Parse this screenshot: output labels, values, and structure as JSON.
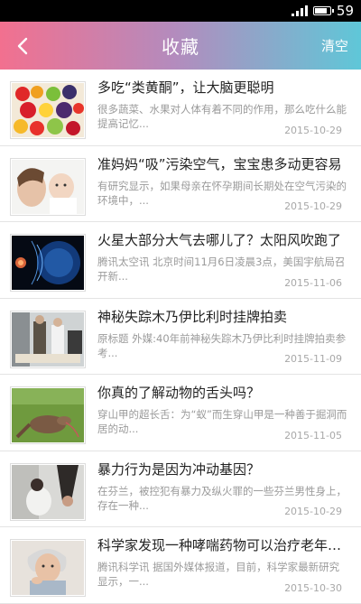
{
  "status_bar": {
    "battery": "59"
  },
  "header": {
    "title": "收藏",
    "clear_label": "清空"
  },
  "items": [
    {
      "title": "多吃“类黄酮”，让大脑更聪明",
      "desc": "很多蔬菜、水果对人体有着不同的作用，那么吃什么能提高记忆...",
      "date": "2015-10-29",
      "thumb": "fruits"
    },
    {
      "title": "准妈妈“吸”污染空气，宝宝患多动更容易",
      "desc": "有研究显示，如果母亲在怀孕期间长期处在空气污染的环境中，...",
      "date": "2015-10-29",
      "thumb": "mother-baby"
    },
    {
      "title": "火星大部分大气去哪儿了？太阳风吹跑了",
      "desc": "腾讯太空讯 北京时间11月6日凌晨3点，美国宇航局召开新...",
      "date": "2015-11-06",
      "thumb": "mars"
    },
    {
      "title": "神秘失踪木乃伊比利时挂牌拍卖",
      "desc": "原标题 外媒:40年前神秘失踪木乃伊比利时挂牌拍卖参考...",
      "date": "2015-11-09",
      "thumb": "mummy"
    },
    {
      "title": "你真的了解动物的舌头吗？",
      "desc": "穿山甲的超长舌：为“蚁”而生穿山甲是一种善于掘洞而居的动...",
      "date": "2015-11-05",
      "thumb": "pangolin"
    },
    {
      "title": "暴力行为是因为冲动基因？",
      "desc": "在芬兰，被控犯有暴力及纵火罪的一些芬兰男性身上，存在一种...",
      "date": "2015-10-29",
      "thumb": "violence"
    },
    {
      "title": "科学家发现一种哮喘药物可以治疗老年痴呆",
      "desc": "腾讯科学讯 据国外媒体报道，目前，科学家最新研究显示，一...",
      "date": "2015-10-30",
      "thumb": "elderly"
    }
  ]
}
